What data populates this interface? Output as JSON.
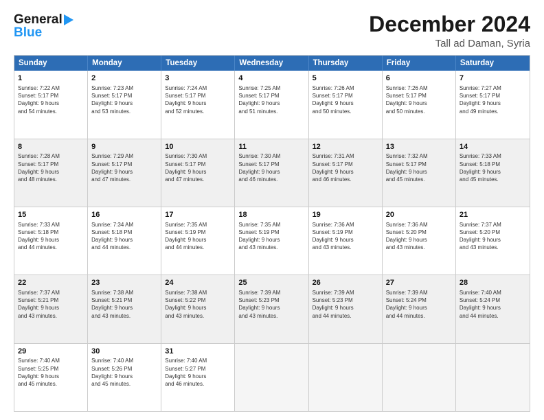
{
  "logo": {
    "line1": "General",
    "line2": "Blue"
  },
  "title": "December 2024",
  "location": "Tall ad Daman, Syria",
  "days": [
    "Sunday",
    "Monday",
    "Tuesday",
    "Wednesday",
    "Thursday",
    "Friday",
    "Saturday"
  ],
  "weeks": [
    [
      {
        "day": "1",
        "info": "Sunrise: 7:22 AM\nSunset: 5:17 PM\nDaylight: 9 hours\nand 54 minutes."
      },
      {
        "day": "2",
        "info": "Sunrise: 7:23 AM\nSunset: 5:17 PM\nDaylight: 9 hours\nand 53 minutes."
      },
      {
        "day": "3",
        "info": "Sunrise: 7:24 AM\nSunset: 5:17 PM\nDaylight: 9 hours\nand 52 minutes."
      },
      {
        "day": "4",
        "info": "Sunrise: 7:25 AM\nSunset: 5:17 PM\nDaylight: 9 hours\nand 51 minutes."
      },
      {
        "day": "5",
        "info": "Sunrise: 7:26 AM\nSunset: 5:17 PM\nDaylight: 9 hours\nand 50 minutes."
      },
      {
        "day": "6",
        "info": "Sunrise: 7:26 AM\nSunset: 5:17 PM\nDaylight: 9 hours\nand 50 minutes."
      },
      {
        "day": "7",
        "info": "Sunrise: 7:27 AM\nSunset: 5:17 PM\nDaylight: 9 hours\nand 49 minutes."
      }
    ],
    [
      {
        "day": "8",
        "info": "Sunrise: 7:28 AM\nSunset: 5:17 PM\nDaylight: 9 hours\nand 48 minutes."
      },
      {
        "day": "9",
        "info": "Sunrise: 7:29 AM\nSunset: 5:17 PM\nDaylight: 9 hours\nand 47 minutes."
      },
      {
        "day": "10",
        "info": "Sunrise: 7:30 AM\nSunset: 5:17 PM\nDaylight: 9 hours\nand 47 minutes."
      },
      {
        "day": "11",
        "info": "Sunrise: 7:30 AM\nSunset: 5:17 PM\nDaylight: 9 hours\nand 46 minutes."
      },
      {
        "day": "12",
        "info": "Sunrise: 7:31 AM\nSunset: 5:17 PM\nDaylight: 9 hours\nand 46 minutes."
      },
      {
        "day": "13",
        "info": "Sunrise: 7:32 AM\nSunset: 5:17 PM\nDaylight: 9 hours\nand 45 minutes."
      },
      {
        "day": "14",
        "info": "Sunrise: 7:33 AM\nSunset: 5:18 PM\nDaylight: 9 hours\nand 45 minutes."
      }
    ],
    [
      {
        "day": "15",
        "info": "Sunrise: 7:33 AM\nSunset: 5:18 PM\nDaylight: 9 hours\nand 44 minutes."
      },
      {
        "day": "16",
        "info": "Sunrise: 7:34 AM\nSunset: 5:18 PM\nDaylight: 9 hours\nand 44 minutes."
      },
      {
        "day": "17",
        "info": "Sunrise: 7:35 AM\nSunset: 5:19 PM\nDaylight: 9 hours\nand 44 minutes."
      },
      {
        "day": "18",
        "info": "Sunrise: 7:35 AM\nSunset: 5:19 PM\nDaylight: 9 hours\nand 43 minutes."
      },
      {
        "day": "19",
        "info": "Sunrise: 7:36 AM\nSunset: 5:19 PM\nDaylight: 9 hours\nand 43 minutes."
      },
      {
        "day": "20",
        "info": "Sunrise: 7:36 AM\nSunset: 5:20 PM\nDaylight: 9 hours\nand 43 minutes."
      },
      {
        "day": "21",
        "info": "Sunrise: 7:37 AM\nSunset: 5:20 PM\nDaylight: 9 hours\nand 43 minutes."
      }
    ],
    [
      {
        "day": "22",
        "info": "Sunrise: 7:37 AM\nSunset: 5:21 PM\nDaylight: 9 hours\nand 43 minutes."
      },
      {
        "day": "23",
        "info": "Sunrise: 7:38 AM\nSunset: 5:21 PM\nDaylight: 9 hours\nand 43 minutes."
      },
      {
        "day": "24",
        "info": "Sunrise: 7:38 AM\nSunset: 5:22 PM\nDaylight: 9 hours\nand 43 minutes."
      },
      {
        "day": "25",
        "info": "Sunrise: 7:39 AM\nSunset: 5:23 PM\nDaylight: 9 hours\nand 43 minutes."
      },
      {
        "day": "26",
        "info": "Sunrise: 7:39 AM\nSunset: 5:23 PM\nDaylight: 9 hours\nand 44 minutes."
      },
      {
        "day": "27",
        "info": "Sunrise: 7:39 AM\nSunset: 5:24 PM\nDaylight: 9 hours\nand 44 minutes."
      },
      {
        "day": "28",
        "info": "Sunrise: 7:40 AM\nSunset: 5:24 PM\nDaylight: 9 hours\nand 44 minutes."
      }
    ],
    [
      {
        "day": "29",
        "info": "Sunrise: 7:40 AM\nSunset: 5:25 PM\nDaylight: 9 hours\nand 45 minutes."
      },
      {
        "day": "30",
        "info": "Sunrise: 7:40 AM\nSunset: 5:26 PM\nDaylight: 9 hours\nand 45 minutes."
      },
      {
        "day": "31",
        "info": "Sunrise: 7:40 AM\nSunset: 5:27 PM\nDaylight: 9 hours\nand 46 minutes."
      },
      {
        "day": "",
        "info": ""
      },
      {
        "day": "",
        "info": ""
      },
      {
        "day": "",
        "info": ""
      },
      {
        "day": "",
        "info": ""
      }
    ]
  ]
}
